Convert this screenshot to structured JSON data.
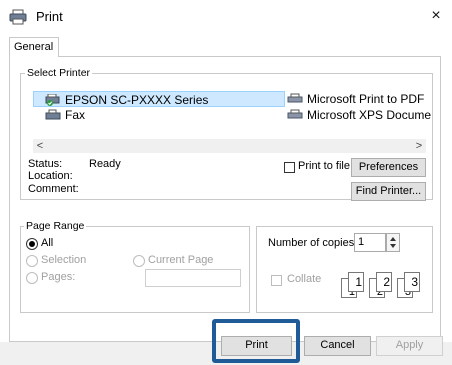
{
  "window": {
    "title": "Print",
    "close_glyph": "×",
    "icon": "printer-icon"
  },
  "tabs": [
    {
      "label": "General",
      "active": true
    }
  ],
  "select_printer": {
    "group_label": "Select Printer",
    "printers": [
      {
        "name": "EPSON SC-PXXXX Series",
        "icon": "printer-default-icon",
        "selected": true
      },
      {
        "name": "Fax",
        "icon": "fax-icon",
        "selected": false
      },
      {
        "name": "Microsoft Print to PDF",
        "icon": "printer-icon",
        "selected": false
      },
      {
        "name": "Microsoft XPS Docume",
        "icon": "printer-icon",
        "selected": false
      }
    ],
    "scroll_left": "<",
    "scroll_right": ">",
    "status_label": "Status:",
    "status_value": "Ready",
    "location_label": "Location:",
    "comment_label": "Comment:",
    "print_to_file_label": "Print to file",
    "preferences_button": "Preferences",
    "find_printer_button": "Find Printer..."
  },
  "page_range": {
    "group_label": "Page Range",
    "all_label": "All",
    "selection_label": "Selection",
    "current_page_label": "Current Page",
    "pages_label": "Pages:",
    "selected_option": "All"
  },
  "copies": {
    "number_label": "Number of copies:",
    "number_value": "1",
    "collate_label": "Collate"
  },
  "footer": {
    "print_button": "Print",
    "cancel_button": "Cancel",
    "apply_button": "Apply"
  },
  "colors": {
    "highlight_frame": "#1f5b96",
    "selection_bg": "#cde8ff"
  }
}
